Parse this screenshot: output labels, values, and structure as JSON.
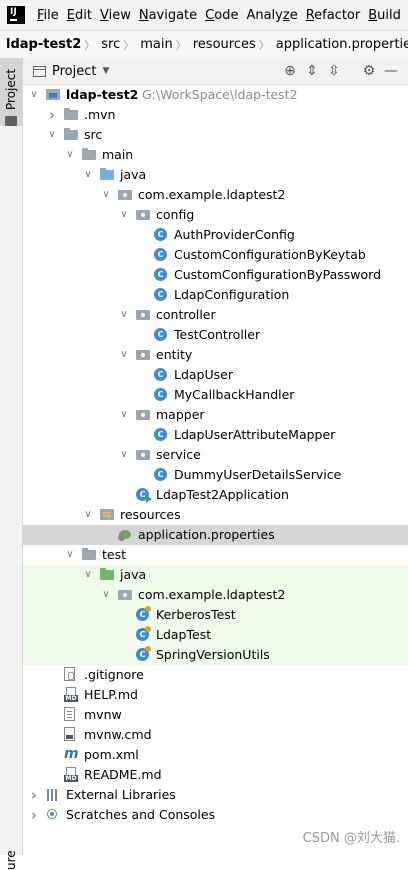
{
  "menubar": {
    "app_logo": "IJ",
    "items": [
      {
        "label": "File",
        "mnemonic": "F"
      },
      {
        "label": "Edit",
        "mnemonic": "E"
      },
      {
        "label": "View",
        "mnemonic": "V"
      },
      {
        "label": "Navigate",
        "mnemonic": "N"
      },
      {
        "label": "Code",
        "mnemonic": "C"
      },
      {
        "label": "Analyze",
        "mnemonic": "z"
      },
      {
        "label": "Refactor",
        "mnemonic": "R"
      },
      {
        "label": "Build",
        "mnemonic": "B"
      }
    ]
  },
  "breadcrumb": {
    "items": [
      "ldap-test2",
      "src",
      "main",
      "resources",
      "application.properties"
    ]
  },
  "left_strip": {
    "tab_project": "Project",
    "tab_structure": "ure"
  },
  "panel": {
    "title": "Project",
    "buttons": [
      {
        "name": "locate-icon",
        "glyph": "⊕"
      },
      {
        "name": "expand-all-icon",
        "glyph": "⇕"
      },
      {
        "name": "collapse-all-icon",
        "glyph": "⇳"
      },
      {
        "name": "gear-icon",
        "glyph": "⚙"
      },
      {
        "name": "hide-icon",
        "glyph": "—"
      }
    ]
  },
  "tree": [
    {
      "label": "ldap-test2",
      "path": "G:\\WorkSpace\\ldap-test2",
      "icon": "module",
      "arrow": "down",
      "bold": true
    },
    {
      "label": ".mvn",
      "icon": "folder-grey",
      "arrow": "right"
    },
    {
      "label": "src",
      "icon": "folder-grey",
      "arrow": "down"
    },
    {
      "label": "main",
      "icon": "folder-grey",
      "arrow": "down"
    },
    {
      "label": "java",
      "icon": "folder-blue",
      "arrow": "down"
    },
    {
      "label": "com.example.ldaptest2",
      "icon": "package",
      "arrow": "down"
    },
    {
      "label": "config",
      "icon": "package",
      "arrow": "down"
    },
    {
      "label": "AuthProviderConfig",
      "icon": "class"
    },
    {
      "label": "CustomConfigurationByKeytab",
      "icon": "class"
    },
    {
      "label": "CustomConfigurationByPassword",
      "icon": "class"
    },
    {
      "label": "LdapConfiguration",
      "icon": "class"
    },
    {
      "label": "controller",
      "icon": "package",
      "arrow": "down"
    },
    {
      "label": "TestController",
      "icon": "class"
    },
    {
      "label": "entity",
      "icon": "package",
      "arrow": "down"
    },
    {
      "label": "LdapUser",
      "icon": "class"
    },
    {
      "label": "MyCallbackHandler",
      "icon": "class"
    },
    {
      "label": "mapper",
      "icon": "package",
      "arrow": "down"
    },
    {
      "label": "LdapUserAttributeMapper",
      "icon": "class"
    },
    {
      "label": "service",
      "icon": "package",
      "arrow": "down"
    },
    {
      "label": "DummyUserDetailsService",
      "icon": "class"
    },
    {
      "label": "LdapTest2Application",
      "icon": "class-run"
    },
    {
      "label": "resources",
      "icon": "folder-res",
      "arrow": "down"
    },
    {
      "label": "application.properties",
      "icon": "leaf",
      "selected": true
    },
    {
      "label": "test",
      "icon": "folder-grey",
      "arrow": "down"
    },
    {
      "label": "java",
      "icon": "folder-green",
      "arrow": "down",
      "test": true
    },
    {
      "label": "com.example.ldaptest2",
      "icon": "package",
      "arrow": "down",
      "test": true
    },
    {
      "label": "KerberosTest",
      "icon": "class-test",
      "test": true
    },
    {
      "label": "LdapTest",
      "icon": "class-test",
      "test": true
    },
    {
      "label": "SpringVersionUtils",
      "icon": "class-test",
      "test": true
    },
    {
      "label": ".gitignore",
      "icon": "gitignore"
    },
    {
      "label": "HELP.md",
      "icon": "md"
    },
    {
      "label": "mvnw",
      "icon": "file"
    },
    {
      "label": "mvnw.cmd",
      "icon": "cmd"
    },
    {
      "label": "pom.xml",
      "icon": "pom"
    },
    {
      "label": "README.md",
      "icon": "md"
    },
    {
      "label": "External Libraries",
      "icon": "libs",
      "arrow": "right"
    },
    {
      "label": "Scratches and Consoles",
      "icon": "scratch",
      "arrow": "right"
    }
  ],
  "watermark": "CSDN @刘大猫."
}
